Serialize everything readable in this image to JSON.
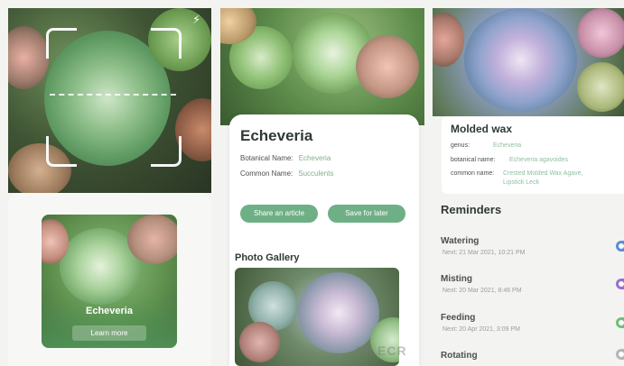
{
  "scanner": {
    "flash_icon": "flash-icon",
    "result": {
      "name": "Echeveria",
      "learn_more": "Learn more"
    }
  },
  "detail": {
    "title": "Echeveria",
    "botanical_label": "Botanical Name:",
    "botanical_value": "Echeveria",
    "common_label": "Common Name:",
    "common_value": "Succulents",
    "share_button": "Share an article",
    "save_button": "Save for later",
    "gallery_label": "Photo Gallery",
    "watermark": "FILECR"
  },
  "plant_card": {
    "title": "Molded wax",
    "genus_label": "genus:",
    "genus_value": "Echeveria",
    "botanical_label": "botanical name:",
    "botanical_value": "Echeveria agavoides",
    "common_label": "common name:",
    "common_value_1": "Crested Molded Wax Agave,",
    "common_value_2": "Lipstick Leck"
  },
  "reminders": {
    "title": "Reminders",
    "items": [
      {
        "label": "Watering",
        "next": "Next: 21 Mar 2021, 10:21 PM",
        "color": "#5b8fd6"
      },
      {
        "label": "Misting",
        "next": "Next: 20 Mar 2021, 8:46 PM",
        "color": "#9a6fd1"
      },
      {
        "label": "Feeding",
        "next": "Next: 20 Apr 2021, 3:09 PM",
        "color": "#6fbf7a"
      },
      {
        "label": "Rotating",
        "next": "",
        "color": "#b5b5b5"
      }
    ]
  },
  "colors": {
    "accent": "#6faf86",
    "text_dark": "#2f3a33"
  }
}
